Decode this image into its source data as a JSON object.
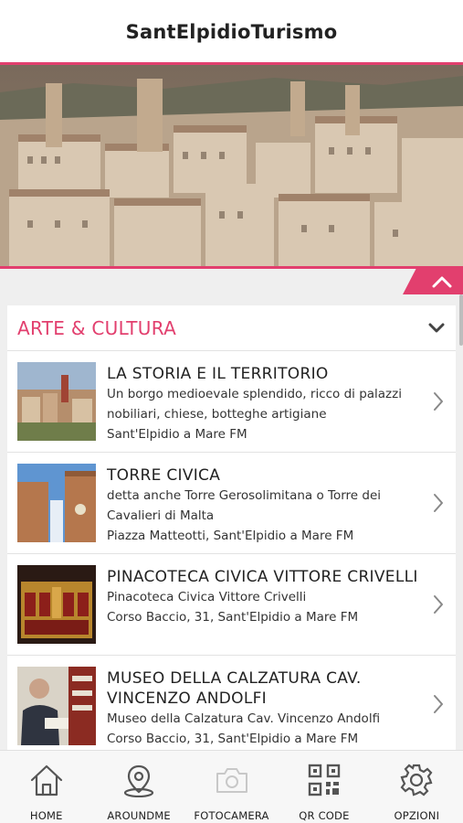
{
  "app": {
    "title": "SantElpidioTurismo"
  },
  "colors": {
    "accent": "#e23f6e",
    "text": "#222222",
    "background": "#efefef"
  },
  "section": {
    "title": "ARTE & CULTURA",
    "toggle_icon": "chevron-down-icon",
    "items": [
      {
        "title": "LA STORIA E IL TERRITORIO",
        "description": "Un borgo medioevale splendido, ricco di palazzi nobiliari, chiese, botteghe artigiane",
        "address": "Sant'Elpidio a Mare FM"
      },
      {
        "title": "TORRE CIVICA",
        "description": "detta anche Torre Gerosolimitana o Torre dei Cavalieri di Malta",
        "address": "Piazza Matteotti, Sant'Elpidio a Mare FM"
      },
      {
        "title": "PINACOTECA CIVICA VITTORE CRIVELLI",
        "description": "Pinacoteca Civica Vittore Crivelli",
        "address": "Corso Baccio, 31, Sant'Elpidio a Mare FM"
      },
      {
        "title": "MUSEO DELLA CALZATURA CAV. VINCENZO ANDOLFI",
        "description": "Museo della Calzatura Cav. Vincenzo Andolfi",
        "address": "Corso Baccio, 31, Sant'Elpidio a Mare FM"
      }
    ]
  },
  "tabbar": {
    "tabs": [
      {
        "label": "HOME",
        "icon": "home-icon"
      },
      {
        "label": "AROUNDME",
        "icon": "location-pin-icon"
      },
      {
        "label": "FOTOCAMERA",
        "icon": "camera-icon"
      },
      {
        "label": "QR CODE",
        "icon": "qr-code-icon"
      },
      {
        "label": "OPZIONI",
        "icon": "gear-icon"
      }
    ]
  }
}
